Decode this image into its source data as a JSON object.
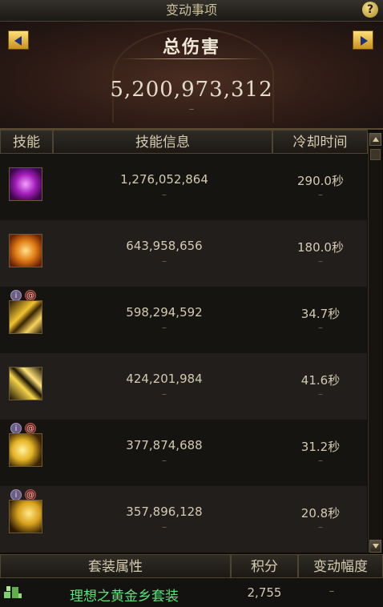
{
  "window": {
    "title": "变动事项",
    "help_label": "?"
  },
  "header": {
    "title": "总伤害",
    "total_damage": "5,200,973,312",
    "change": "–"
  },
  "columns": {
    "skill": "技能",
    "info": "技能信息",
    "cooldown": "冷却时间"
  },
  "skills": [
    {
      "icon": "purple-rune-skill-icon",
      "damage": "1,276,052,864",
      "damage_change": "–",
      "cooldown": "290.0秒",
      "cooldown_change": "–",
      "badges": []
    },
    {
      "icon": "fire-burst-skill-icon",
      "damage": "643,958,656",
      "damage_change": "–",
      "cooldown": "180.0秒",
      "cooldown_change": "–",
      "badges": []
    },
    {
      "icon": "golden-slash-skill-icon",
      "damage": "598,294,592",
      "damage_change": "–",
      "cooldown": "34.7秒",
      "cooldown_change": "–",
      "badges": [
        "i",
        "s"
      ]
    },
    {
      "icon": "lightning-strike-skill-icon",
      "damage": "424,201,984",
      "damage_change": "–",
      "cooldown": "41.6秒",
      "cooldown_change": "–",
      "badges": []
    },
    {
      "icon": "golden-wing-skill-icon",
      "damage": "377,874,688",
      "damage_change": "–",
      "cooldown": "31.2秒",
      "cooldown_change": "–",
      "badges": [
        "i",
        "s"
      ]
    },
    {
      "icon": "golden-claw-skill-icon",
      "damage": "357,896,128",
      "damage_change": "–",
      "cooldown": "20.8秒",
      "cooldown_change": "–",
      "badges": [
        "i",
        "s"
      ]
    }
  ],
  "footer": {
    "columns": {
      "set_attr": "套装属性",
      "score": "积分",
      "change": "变动幅度"
    },
    "set": {
      "name": "理想之黄金乡套装",
      "score": "2,755",
      "change": "–",
      "icon": "set-bonus-icon"
    }
  },
  "colors": {
    "accent_gold": "#c8a24a",
    "set_name_green": "#5ce27a",
    "arrow_blue": "#1f2f7a"
  }
}
